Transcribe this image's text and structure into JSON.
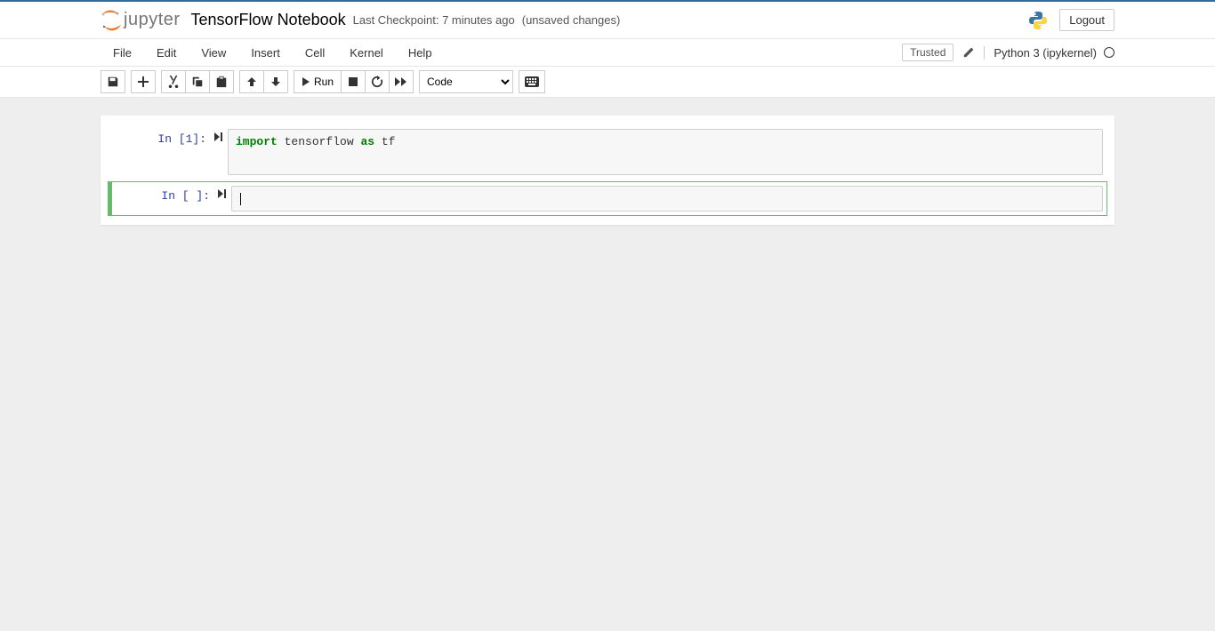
{
  "header": {
    "logo_text": "jupyter",
    "notebook_title": "TensorFlow Notebook",
    "checkpoint": "Last Checkpoint: 7 minutes ago",
    "unsaved": "(unsaved changes)",
    "logout": "Logout"
  },
  "menubar": {
    "items": [
      "File",
      "Edit",
      "View",
      "Insert",
      "Cell",
      "Kernel",
      "Help"
    ],
    "trusted": "Trusted",
    "kernel": "Python 3 (ipykernel)"
  },
  "toolbar": {
    "run_label": "Run",
    "cell_type": "Code"
  },
  "cells": [
    {
      "prompt": "In [1]:",
      "code_tokens": [
        {
          "t": "import",
          "c": "kw-import"
        },
        {
          "t": " tensorflow ",
          "c": ""
        },
        {
          "t": "as",
          "c": "kw-as"
        },
        {
          "t": " tf",
          "c": ""
        }
      ]
    },
    {
      "prompt": "In [ ]:",
      "code_tokens": []
    }
  ]
}
